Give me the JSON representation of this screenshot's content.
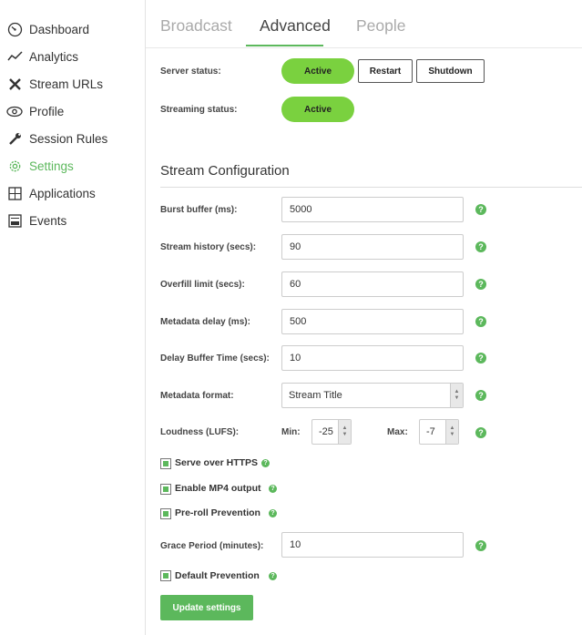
{
  "sidebar": {
    "items": [
      {
        "label": "Dashboard",
        "icon": "dashboard-gauge-icon"
      },
      {
        "label": "Analytics",
        "icon": "analytics-line-icon"
      },
      {
        "label": "Stream URLs",
        "icon": "tools-icon"
      },
      {
        "label": "Profile",
        "icon": "eye-icon"
      },
      {
        "label": "Session Rules",
        "icon": "wrench-icon"
      },
      {
        "label": "Settings",
        "icon": "gear-icon",
        "active": true
      },
      {
        "label": "Applications",
        "icon": "puzzle-icon"
      },
      {
        "label": "Events",
        "icon": "log-icon"
      }
    ]
  },
  "tabs": [
    {
      "label": "Broadcast"
    },
    {
      "label": "Advanced",
      "active": true
    },
    {
      "label": "People"
    }
  ],
  "server": {
    "status_label": "Server status:",
    "status_value": "Active",
    "restart_label": "Restart",
    "shutdown_label": "Shutdown",
    "streaming_label": "Streaming status:",
    "streaming_value": "Active"
  },
  "config": {
    "title": "Stream Configuration",
    "fields": [
      {
        "label": "Burst buffer (ms):",
        "value": "5000"
      },
      {
        "label": "Stream history (secs):",
        "value": "90"
      },
      {
        "label": "Overfill limit (secs):",
        "value": "60"
      },
      {
        "label": "Metadata delay (ms):",
        "value": "500"
      },
      {
        "label": "Delay Buffer Time (secs):",
        "value": "10"
      }
    ],
    "metadata_format": {
      "label": "Metadata format:",
      "value": "Stream Title"
    },
    "loudness": {
      "label": "Loudness (LUFS):",
      "min_label": "Min:",
      "min_value": "-25",
      "max_label": "Max:",
      "max_value": "-7"
    },
    "checkboxes": [
      {
        "label": "Serve over HTTPS",
        "checked": true
      },
      {
        "label": "Enable MP4 output",
        "checked": true
      },
      {
        "label": "Pre-roll Prevention",
        "checked": true
      }
    ],
    "grace_period": {
      "label": "Grace Period (minutes):",
      "value": "10"
    },
    "default_prevention": {
      "label": "Default Prevention",
      "checked": true
    },
    "help_glyph": "?",
    "update_label": "Update settings"
  },
  "colors": {
    "accent": "#5cb85c",
    "active_pill": "#7ad13f"
  }
}
